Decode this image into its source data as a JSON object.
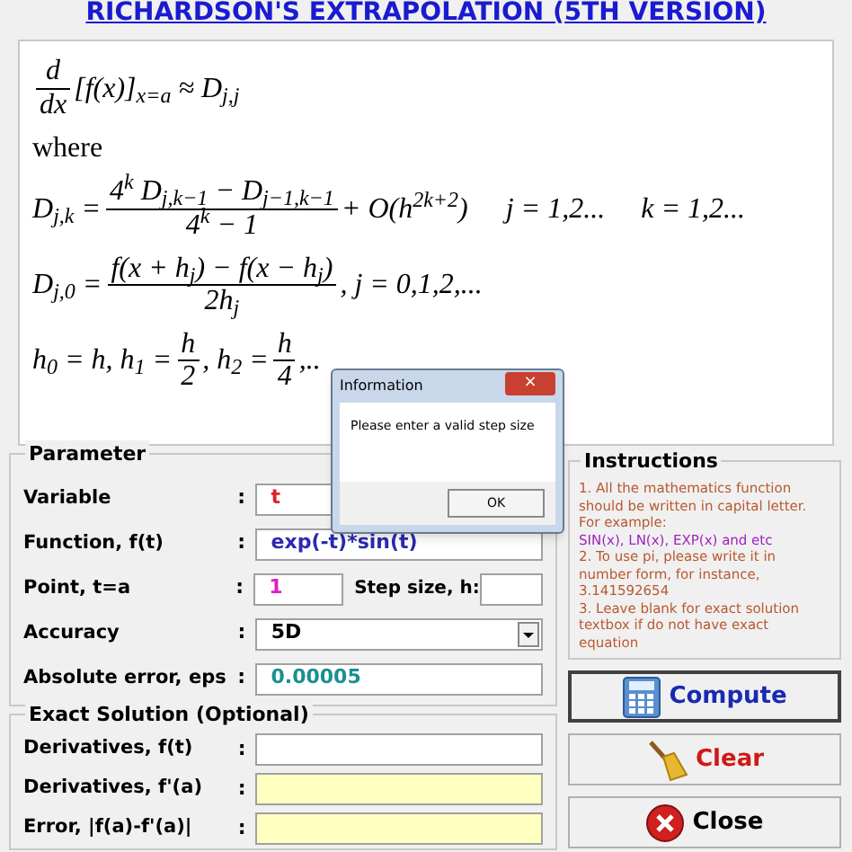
{
  "title": "RICHARDSON'S EXTRAPOLATION (5TH VERSION)",
  "formulas": [
    {
      "parts": [
        {
          "kind": "frac",
          "num": "d",
          "den": "dx"
        },
        {
          "kind": "text",
          "text": "[f(x)]$_{x=a}$ ≈ D$_{j,j}$"
        }
      ]
    },
    {
      "parts": [
        {
          "kind": "plain",
          "text": "where"
        }
      ]
    },
    {
      "parts": [
        {
          "kind": "text",
          "text": "D$_{j,k}$ = "
        },
        {
          "kind": "frac",
          "num": "4$^{k}$ D$_{j,k−1}$ − D$_{j−1,k−1}$",
          "den": "4$^{k}$ − 1"
        },
        {
          "kind": "text",
          "text": " + O(h$^{2k+2}$)"
        },
        {
          "kind": "spaced",
          "text": "j = 1,2..."
        },
        {
          "kind": "spaced",
          "text": "k = 1,2..."
        }
      ]
    },
    {
      "parts": [
        {
          "kind": "text",
          "text": "D$_{j,0}$ = "
        },
        {
          "kind": "frac",
          "num": "f(x + h$_{j}$) − f(x − h$_{j}$)",
          "den": "2h$_{j}$"
        },
        {
          "kind": "text",
          "text": ",   j = 0,1,2,..."
        }
      ]
    },
    {
      "parts": [
        {
          "kind": "text",
          "text": "h$_{0}$ = h, h$_{1}$ = "
        },
        {
          "kind": "frac",
          "num": "h",
          "den": "2"
        },
        {
          "kind": "text",
          "text": ", h$_{2}$ = "
        },
        {
          "kind": "frac",
          "num": "h",
          "den": "4"
        },
        {
          "kind": "text",
          "text": ",.."
        }
      ]
    }
  ],
  "parameter": {
    "legend": "Parameter",
    "rows": [
      {
        "kind": "field",
        "label": "Variable",
        "colon": ":",
        "value": "t",
        "color": "#e0202a"
      },
      {
        "kind": "field",
        "label": "Function, f(t)",
        "colon": ":",
        "value": "exp(-t)*sin(t)",
        "color": "#2a2ab0"
      },
      {
        "kind": "pair",
        "label": "Point,  t=a",
        "colon": ":",
        "value": "1",
        "color": "#e020c0",
        "label2": "Step size, h:"
      },
      {
        "kind": "dropdown",
        "label": "Accuracy",
        "colon": ":",
        "value": "5D",
        "color": "#000000"
      },
      {
        "kind": "field",
        "label": "Absolute error, eps",
        "colon": ":",
        "value": "0.00005",
        "color": "#1a9090"
      }
    ]
  },
  "exact": {
    "legend": "Exact Solution (Optional)",
    "rows": [
      {
        "label": "Derivatives, f(t)",
        "colon": ":",
        "readonly": false
      },
      {
        "label": "Derivatives, f'(a)",
        "colon": ":",
        "readonly": true
      },
      {
        "label": "Error, |f(a)-f'(a)|",
        "colon": ":",
        "readonly": true
      }
    ]
  },
  "instructions": {
    "legend": "Instructions",
    "lines": [
      {
        "text": "1. All the mathematics function should be written in capital letter. For example:",
        "color": "#b8582e"
      },
      {
        "text": "SIN(x), LN(x), EXP(x) and etc",
        "color": "#a020c0"
      },
      {
        "text": "2. To use pi, please write it in number form, for instance, 3.141592654",
        "color": "#b8582e"
      },
      {
        "text": "3. Leave blank for exact solution textbox if do not have exact equation",
        "color": "#b8582e"
      }
    ]
  },
  "buttons": [
    {
      "kind": "compute",
      "label": "Compute"
    },
    {
      "kind": "clear",
      "label": "Clear"
    },
    {
      "kind": "close",
      "label": "Close"
    }
  ],
  "dialog": {
    "title": "Information",
    "close": "×",
    "message": "Please enter a valid step size",
    "ok": "OK"
  }
}
